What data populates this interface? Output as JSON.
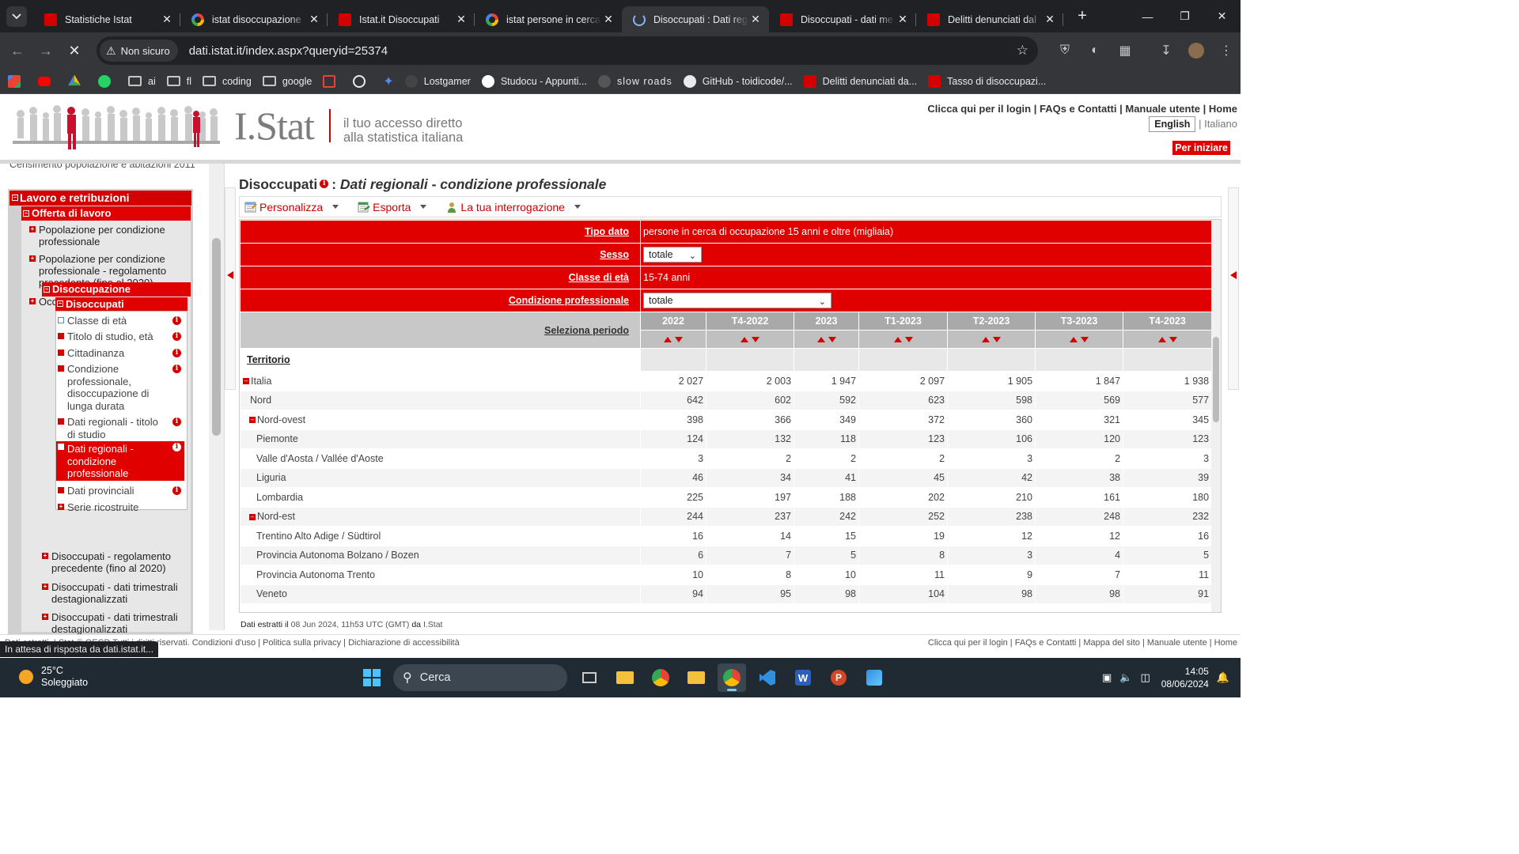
{
  "browser": {
    "tabs": [
      {
        "title": "Statistiche Istat",
        "icon": "istat-favicon",
        "active": false
      },
      {
        "title": "istat disoccupazione",
        "icon": "google-favicon",
        "active": false
      },
      {
        "title": "Istat.it Disoccupati",
        "icon": "istat-favicon",
        "active": false
      },
      {
        "title": "istat persone in cerca",
        "icon": "google-favicon",
        "active": false
      },
      {
        "title": "Disoccupati : Dati reg",
        "icon": "loading-favicon",
        "active": true
      },
      {
        "title": "Disoccupati - dati me",
        "icon": "istat-favicon",
        "active": false
      },
      {
        "title": "Delitti denunciati dal",
        "icon": "istat-favicon",
        "active": false
      }
    ],
    "security_label": "Non sicuro",
    "url": "dati.istat.it/index.aspx?queryid=25374",
    "bookmarks": [
      "ai",
      "fl",
      "coding",
      "google",
      "Lostgamer",
      "Studocu - Appunti...",
      "slow roads",
      "GitHub - toidicode/...",
      "Delitti denunciati da...",
      "Tasso di disoccupazi..."
    ],
    "status_text": "In attesa di risposta da dati.istat.it..."
  },
  "header": {
    "logo_text": "I.Stat",
    "tagline_1": "il tuo accesso diretto",
    "tagline_2": "alla statistica italiana",
    "links": [
      "Clicca qui per il login",
      "FAQs e Contatti",
      "Manuale utente",
      "Home"
    ],
    "lang_english": "English",
    "lang_italiano": "Italiano",
    "per_iniziare": "Per iniziare"
  },
  "sidebar": {
    "cut_item": "Censimento popolazione e abitazioni 2011",
    "section": "Lavoro e retribuzioni",
    "subsection": "Offerta di lavoro",
    "items": [
      "Popolazione per condizione professionale",
      "Popolazione per condizione professionale - regolamento precedente (fino al 2020)",
      "Occupazione"
    ],
    "disoccupazione": "Disoccupazione",
    "disoccupati": "Disoccupati",
    "subitems": [
      "Classe di età",
      "Titolo di studio, età",
      "Cittadinanza",
      "Condizione professionale, disoccupazione di lunga durata",
      "Dati regionali - titolo di studio",
      "Dati regionali - condizione professionale",
      "Dati provinciali",
      "Serie ricostruite"
    ],
    "after_items": [
      "Disoccupati - regolamento precedente (fino al 2020)",
      "Disoccupati - dati trimestrali destagionalizzati",
      "Disoccupati - dati trimestrali destagionalizzati"
    ]
  },
  "main": {
    "title": "Disoccupati",
    "subtitle": "Dati regionali - condizione professionale",
    "actions": [
      "Personalizza",
      "Esporta",
      "La tua interrogazione"
    ],
    "params": [
      {
        "label": "Tipo dato",
        "value": "persone in cerca di occupazione 15 anni e oltre (migliaia)",
        "select": false
      },
      {
        "label": "Sesso",
        "value": "totale",
        "select": true
      },
      {
        "label": "Classe di età",
        "value": "15-74 anni",
        "select": false
      },
      {
        "label": "Condizione professionale",
        "value": "totale",
        "select": true
      }
    ],
    "period_label": "Seleziona periodo",
    "periods": [
      "2022",
      "T4-2022",
      "2023",
      "T1-2023",
      "T2-2023",
      "T3-2023",
      "T4-2023"
    ],
    "territory_label": "Territorio",
    "rows": [
      {
        "name": "Italia",
        "level": 0,
        "collapsible": true,
        "values": [
          "2 027",
          "2 003",
          "1 947",
          "2 097",
          "1 905",
          "1 847",
          "1 938"
        ]
      },
      {
        "name": "Nord",
        "level": 1,
        "collapsible": false,
        "values": [
          "642",
          "602",
          "592",
          "623",
          "598",
          "569",
          "577"
        ]
      },
      {
        "name": "Nord-ovest",
        "level": 1,
        "collapsible": true,
        "values": [
          "398",
          "366",
          "349",
          "372",
          "360",
          "321",
          "345"
        ]
      },
      {
        "name": "Piemonte",
        "level": 2,
        "collapsible": false,
        "values": [
          "124",
          "132",
          "118",
          "123",
          "106",
          "120",
          "123"
        ]
      },
      {
        "name": "Valle d'Aosta / Vallée d'Aoste",
        "level": 2,
        "collapsible": false,
        "values": [
          "3",
          "2",
          "2",
          "2",
          "3",
          "2",
          "3"
        ]
      },
      {
        "name": "Liguria",
        "level": 2,
        "collapsible": false,
        "values": [
          "46",
          "34",
          "41",
          "45",
          "42",
          "38",
          "39"
        ]
      },
      {
        "name": "Lombardia",
        "level": 2,
        "collapsible": false,
        "values": [
          "225",
          "197",
          "188",
          "202",
          "210",
          "161",
          "180"
        ]
      },
      {
        "name": "Nord-est",
        "level": 1,
        "collapsible": true,
        "values": [
          "244",
          "237",
          "242",
          "252",
          "238",
          "248",
          "232"
        ]
      },
      {
        "name": "Trentino Alto Adige / Südtirol",
        "level": 2,
        "collapsible": false,
        "values": [
          "16",
          "14",
          "15",
          "19",
          "12",
          "12",
          "16"
        ]
      },
      {
        "name": "Provincia Autonoma Bolzano / Bozen",
        "level": 2,
        "collapsible": false,
        "values": [
          "6",
          "7",
          "5",
          "8",
          "3",
          "4",
          "5"
        ]
      },
      {
        "name": "Provincia Autonoma Trento",
        "level": 2,
        "collapsible": false,
        "values": [
          "10",
          "8",
          "10",
          "11",
          "9",
          "7",
          "11"
        ]
      },
      {
        "name": "Veneto",
        "level": 2,
        "collapsible": false,
        "values": [
          "94",
          "95",
          "98",
          "104",
          "98",
          "98",
          "91"
        ]
      }
    ],
    "footnote_prefix": "Dati estratti il",
    "footnote_date": "08 Jun 2024, 11h53 UTC (GMT)",
    "footnote_da": "da",
    "footnote_source": "I.Stat"
  },
  "footer": {
    "left": "Dati estratti. I.Stat © OECD Tutti i diritti riservati. Condizioni d'uso | Politica sulla privacy | Dichiarazione di accessibilità",
    "right": "Clicca qui per il login | FAQs e Contatti | Mappa del sito | Manuale utente | Home"
  },
  "taskbar": {
    "temperature": "25°C",
    "weather": "Soleggiato",
    "search_placeholder": "Cerca",
    "time": "14:05",
    "date": "08/06/2024"
  },
  "colors": {
    "accent": "#d40000",
    "header_grey": "#a9a9a9"
  }
}
